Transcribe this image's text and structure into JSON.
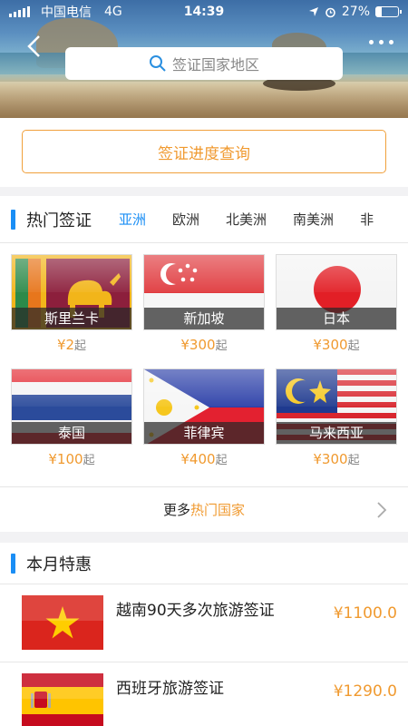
{
  "status": {
    "carrier": "中国电信",
    "network": "4G",
    "time": "14:39",
    "battery": "27%",
    "battery_level": 0.27
  },
  "search": {
    "placeholder": "签证国家地区"
  },
  "progress": {
    "label": "签证进度查询"
  },
  "hot": {
    "title": "热门签证",
    "tabs": [
      "亚洲",
      "欧洲",
      "北美洲",
      "南美洲",
      "非"
    ],
    "cards": [
      {
        "name": "斯里兰卡",
        "price": "¥2",
        "unit": "起",
        "flag": "sri-lanka-flag"
      },
      {
        "name": "新加坡",
        "price": "¥300",
        "unit": "起",
        "flag": "singapore-flag"
      },
      {
        "name": "日本",
        "price": "¥300",
        "unit": "起",
        "flag": "japan-flag"
      },
      {
        "name": "泰国",
        "price": "¥100",
        "unit": "起",
        "flag": "thailand-flag"
      },
      {
        "name": "菲律宾",
        "price": "¥400",
        "unit": "起",
        "flag": "philippines-flag"
      },
      {
        "name": "马来西亚",
        "price": "¥300",
        "unit": "起",
        "flag": "malaysia-flag"
      }
    ],
    "more": {
      "prefix": "更多",
      "highlight": "热门国家"
    }
  },
  "monthly": {
    "title": "本月特惠",
    "deals": [
      {
        "name": "越南90天多次旅游签证",
        "price": "¥1100.0",
        "flag": "vietnam-flag"
      },
      {
        "name": "西班牙旅游签证",
        "price": "¥1290.0",
        "flag": "spain-flag"
      }
    ]
  }
}
